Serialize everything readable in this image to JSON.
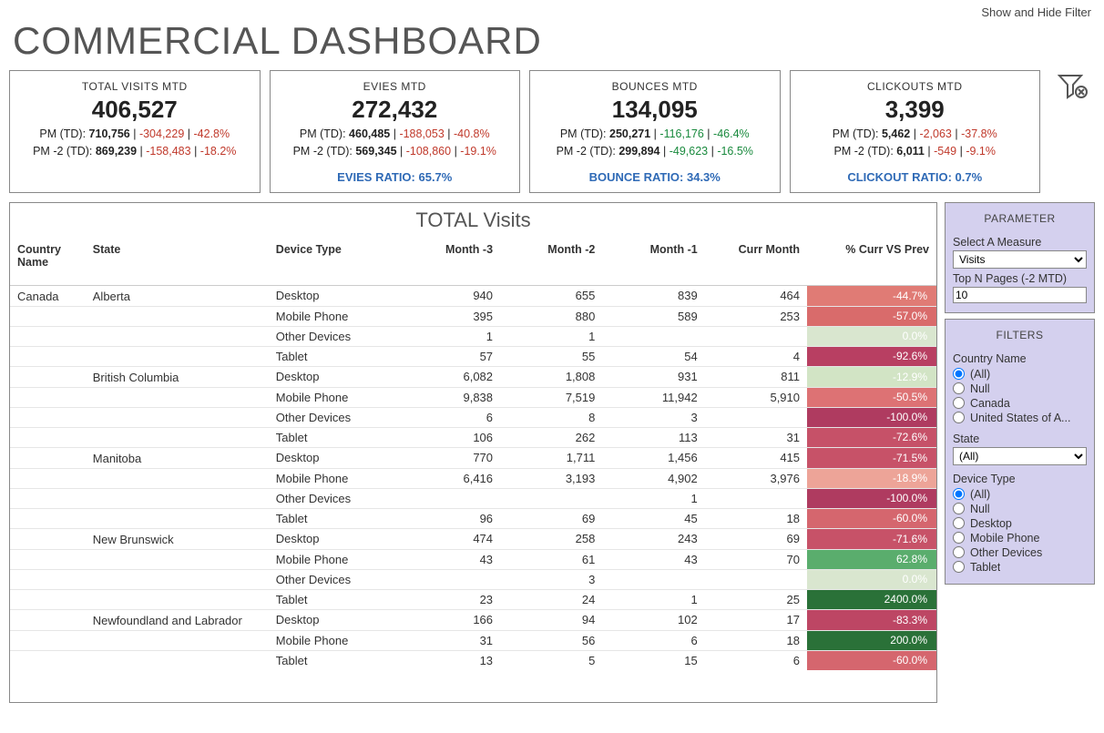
{
  "topLink": "Show and Hide Filter",
  "title": "COMMERCIAL DASHBOARD",
  "kpis": [
    {
      "label": "TOTAL VISITS MTD",
      "value": "406,527",
      "pm": {
        "prefix": "PM (TD): ",
        "base": "710,756",
        "delta": "-304,229",
        "pct": "-42.8%",
        "cls": "neg"
      },
      "pm2": {
        "prefix": "PM -2 (TD): ",
        "base": "869,239",
        "delta": "-158,483",
        "pct": "-18.2%",
        "cls": "neg"
      },
      "ratio": ""
    },
    {
      "label": "EVIES MTD",
      "value": "272,432",
      "pm": {
        "prefix": "PM (TD): ",
        "base": "460,485",
        "delta": "-188,053",
        "pct": "-40.8%",
        "cls": "neg"
      },
      "pm2": {
        "prefix": "PM -2 (TD): ",
        "base": "569,345",
        "delta": "-108,860",
        "pct": "-19.1%",
        "cls": "neg"
      },
      "ratio": "EVIES RATIO: 65.7%"
    },
    {
      "label": "BOUNCES MTD",
      "value": "134,095",
      "pm": {
        "prefix": "PM (TD): ",
        "base": "250,271",
        "delta": "-116,176",
        "pct": "-46.4%",
        "cls": "pos"
      },
      "pm2": {
        "prefix": "PM -2 (TD): ",
        "base": "299,894",
        "delta": "-49,623",
        "pct": "-16.5%",
        "cls": "pos"
      },
      "ratio": "BOUNCE RATIO: 34.3%"
    },
    {
      "label": "CLICKOUTS MTD",
      "value": "3,399",
      "pm": {
        "prefix": "PM (TD): ",
        "base": "5,462",
        "delta": "-2,063",
        "pct": "-37.8%",
        "cls": "neg"
      },
      "pm2": {
        "prefix": "PM -2 (TD): ",
        "base": "6,011",
        "delta": "-549",
        "pct": "-9.1%",
        "cls": "neg"
      },
      "ratio": "CLICKOUT RATIO: 0.7%"
    }
  ],
  "tableTitle": "TOTAL Visits",
  "columns": [
    "Country Name",
    "State",
    "Device Type",
    "Month -3",
    "Month -2",
    "Month -1",
    "Curr Month",
    "% Curr VS Prev"
  ],
  "rows": [
    {
      "country": "Canada",
      "state": "Alberta",
      "device": "Desktop",
      "m3": "940",
      "m2": "655",
      "m1": "839",
      "cur": "464",
      "pct": "-44.7%",
      "bg": "#e07b75"
    },
    {
      "country": "",
      "state": "",
      "device": "Mobile Phone",
      "m3": "395",
      "m2": "880",
      "m1": "589",
      "cur": "253",
      "pct": "-57.0%",
      "bg": "#d96b6b"
    },
    {
      "country": "",
      "state": "",
      "device": "Other Devices",
      "m3": "1",
      "m2": "1",
      "m1": "",
      "cur": "",
      "pct": "0.0%",
      "bg": "#d9e6cf"
    },
    {
      "country": "",
      "state": "",
      "device": "Tablet",
      "m3": "57",
      "m2": "55",
      "m1": "54",
      "cur": "4",
      "pct": "-92.6%",
      "bg": "#b83f62"
    },
    {
      "country": "",
      "state": "British Columbia",
      "device": "Desktop",
      "m3": "6,082",
      "m2": "1,808",
      "m1": "931",
      "cur": "811",
      "pct": "-12.9%",
      "bg": "#d2e4c5"
    },
    {
      "country": "",
      "state": "",
      "device": "Mobile Phone",
      "m3": "9,838",
      "m2": "7,519",
      "m1": "11,942",
      "cur": "5,910",
      "pct": "-50.5%",
      "bg": "#dd7274"
    },
    {
      "country": "",
      "state": "",
      "device": "Other Devices",
      "m3": "6",
      "m2": "8",
      "m1": "3",
      "cur": "",
      "pct": "-100.0%",
      "bg": "#af3b60"
    },
    {
      "country": "",
      "state": "",
      "device": "Tablet",
      "m3": "106",
      "m2": "262",
      "m1": "113",
      "cur": "31",
      "pct": "-72.6%",
      "bg": "#c65168"
    },
    {
      "country": "",
      "state": "Manitoba",
      "device": "Desktop",
      "m3": "770",
      "m2": "1,711",
      "m1": "1,456",
      "cur": "415",
      "pct": "-71.5%",
      "bg": "#c75268"
    },
    {
      "country": "",
      "state": "",
      "device": "Mobile Phone",
      "m3": "6,416",
      "m2": "3,193",
      "m1": "4,902",
      "cur": "3,976",
      "pct": "-18.9%",
      "bg": "#eda498"
    },
    {
      "country": "",
      "state": "",
      "device": "Other Devices",
      "m3": "",
      "m2": "",
      "m1": "1",
      "cur": "",
      "pct": "-100.0%",
      "bg": "#af3b60"
    },
    {
      "country": "",
      "state": "",
      "device": "Tablet",
      "m3": "96",
      "m2": "69",
      "m1": "45",
      "cur": "18",
      "pct": "-60.0%",
      "bg": "#d5666e"
    },
    {
      "country": "",
      "state": "New Brunswick",
      "device": "Desktop",
      "m3": "474",
      "m2": "258",
      "m1": "243",
      "cur": "69",
      "pct": "-71.6%",
      "bg": "#c75268"
    },
    {
      "country": "",
      "state": "",
      "device": "Mobile Phone",
      "m3": "43",
      "m2": "61",
      "m1": "43",
      "cur": "70",
      "pct": "62.8%",
      "bg": "#5aad6d"
    },
    {
      "country": "",
      "state": "",
      "device": "Other Devices",
      "m3": "",
      "m2": "3",
      "m1": "",
      "cur": "",
      "pct": "0.0%",
      "bg": "#d9e6cf"
    },
    {
      "country": "",
      "state": "",
      "device": "Tablet",
      "m3": "23",
      "m2": "24",
      "m1": "1",
      "cur": "25",
      "pct": "2400.0%",
      "bg": "#2a7138"
    },
    {
      "country": "",
      "state": "Newfoundland and Labrador",
      "device": "Desktop",
      "m3": "166",
      "m2": "94",
      "m1": "102",
      "cur": "17",
      "pct": "-83.3%",
      "bg": "#bd4664"
    },
    {
      "country": "",
      "state": "",
      "device": "Mobile Phone",
      "m3": "31",
      "m2": "56",
      "m1": "6",
      "cur": "18",
      "pct": "200.0%",
      "bg": "#2a7138"
    },
    {
      "country": "",
      "state": "",
      "device": "Tablet",
      "m3": "13",
      "m2": "5",
      "m1": "15",
      "cur": "6",
      "pct": "-60.0%",
      "bg": "#d5666e"
    }
  ],
  "sidebar": {
    "parameterHdr": "PARAMETER",
    "measureLabel": "Select A Measure",
    "measureValue": "Visits",
    "topNLabel": "Top N Pages (-2 MTD)",
    "topNValue": "10",
    "filtersHdr": "FILTERS",
    "countryLabel": "Country Name",
    "countryOptions": [
      "(All)",
      "Null",
      "Canada",
      "United States of A..."
    ],
    "countrySelected": 0,
    "stateLabel": "State",
    "stateValue": "(All)",
    "deviceLabel": "Device Type",
    "deviceOptions": [
      "(All)",
      "Null",
      "Desktop",
      "Mobile Phone",
      "Other Devices",
      "Tablet"
    ],
    "deviceSelected": 0
  }
}
